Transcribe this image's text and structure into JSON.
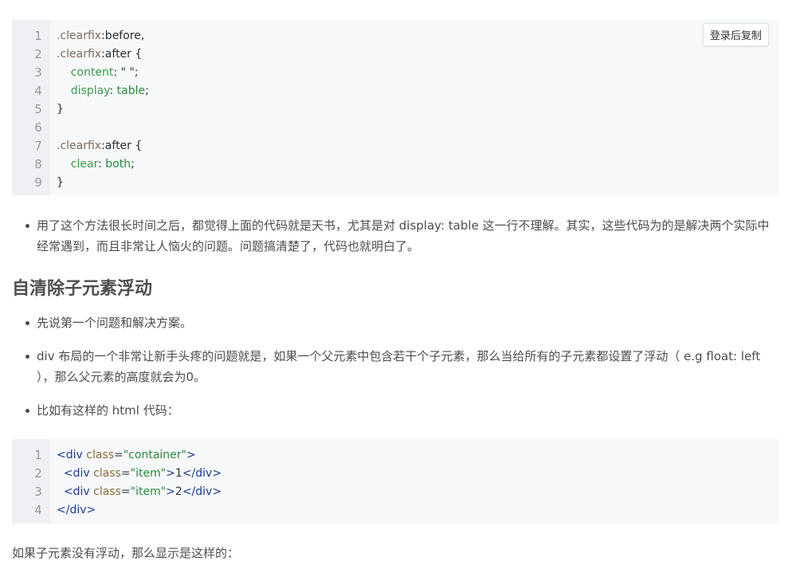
{
  "copy_button": "登录后复制",
  "code1": {
    "line_numbers": [
      "1",
      "2",
      "3",
      "4",
      "5",
      "6",
      "7",
      "8",
      "9"
    ],
    "lines": [
      [
        {
          "t": ".clearfix",
          "c": "sel"
        },
        {
          "t": ":before,",
          "c": "kw"
        }
      ],
      [
        {
          "t": ".clearfix",
          "c": "sel"
        },
        {
          "t": ":after {",
          "c": "kw"
        }
      ],
      [
        {
          "t": "    content",
          "c": "prop"
        },
        {
          "t": ": \" \";",
          "c": "punct"
        }
      ],
      [
        {
          "t": "    display",
          "c": "prop"
        },
        {
          "t": ": ",
          "c": "punct"
        },
        {
          "t": "table",
          "c": "val"
        },
        {
          "t": ";",
          "c": "punct"
        }
      ],
      [
        {
          "t": "}",
          "c": "punct"
        }
      ],
      [
        {
          "t": "",
          "c": "punct"
        }
      ],
      [
        {
          "t": ".clearfix",
          "c": "sel"
        },
        {
          "t": ":after {",
          "c": "kw"
        }
      ],
      [
        {
          "t": "    clear",
          "c": "prop"
        },
        {
          "t": ": ",
          "c": "punct"
        },
        {
          "t": "both",
          "c": "val"
        },
        {
          "t": ";",
          "c": "punct"
        }
      ],
      [
        {
          "t": "}",
          "c": "punct"
        }
      ]
    ]
  },
  "bullet1": "用了这个方法很长时间之后，都觉得上面的代码就是天书，尤其是对 display: table 这一行不理解。其实，这些代码为的是解决两个实际中经常遇到，而且非常让人恼火的问题。问题搞清楚了，代码也就明白了。",
  "heading": "自清除子元素浮动",
  "bullets2": [
    "先说第一个问题和解决方案。",
    "div 布局的一个非常让新手头疼的问题就是，如果一个父元素中包含若干个子元素，那么当给所有的子元素都设置了浮动（ e.g float: left ），那么父元素的高度就会为0。",
    "比如有这样的 html 代码："
  ],
  "code2": {
    "line_numbers": [
      "1",
      "2",
      "3",
      "4"
    ],
    "lines": [
      [
        {
          "t": "<div ",
          "c": "tag"
        },
        {
          "t": "class",
          "c": "attr"
        },
        {
          "t": "=",
          "c": "punct"
        },
        {
          "t": "\"container\"",
          "c": "str"
        },
        {
          "t": ">",
          "c": "tag"
        }
      ],
      [
        {
          "t": "  <div ",
          "c": "tag"
        },
        {
          "t": "class",
          "c": "attr"
        },
        {
          "t": "=",
          "c": "punct"
        },
        {
          "t": "\"item\"",
          "c": "str"
        },
        {
          "t": ">",
          "c": "tag"
        },
        {
          "t": "1",
          "c": "punct"
        },
        {
          "t": "</div>",
          "c": "tag"
        }
      ],
      [
        {
          "t": "  <div ",
          "c": "tag"
        },
        {
          "t": "class",
          "c": "attr"
        },
        {
          "t": "=",
          "c": "punct"
        },
        {
          "t": "\"item\"",
          "c": "str"
        },
        {
          "t": ">",
          "c": "tag"
        },
        {
          "t": "2",
          "c": "punct"
        },
        {
          "t": "</div>",
          "c": "tag"
        }
      ],
      [
        {
          "t": "</div>",
          "c": "tag"
        }
      ]
    ]
  },
  "paragraph": "如果子元素没有浮动，那么显示是这样的："
}
